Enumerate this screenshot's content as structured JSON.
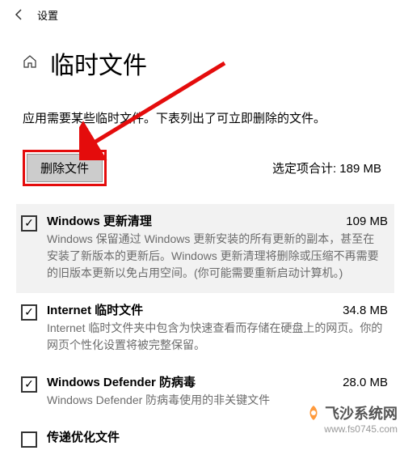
{
  "titlebar": {
    "settings_label": "设置"
  },
  "header": {
    "page_title": "临时文件"
  },
  "description": "应用需要某些临时文件。下表列出了可立即删除的文件。",
  "action": {
    "delete_label": "删除文件",
    "total_label": "选定项合计: 189 MB"
  },
  "items": [
    {
      "checked": true,
      "selected": true,
      "title": "Windows 更新清理",
      "size": "109 MB",
      "desc": "Windows 保留通过 Windows 更新安装的所有更新的副本，甚至在安装了新版本的更新后。Windows 更新清理将删除或压缩不再需要的旧版本更新以免占用空间。(你可能需要重新启动计算机。)"
    },
    {
      "checked": true,
      "selected": false,
      "title": "Internet 临时文件",
      "size": "34.8 MB",
      "desc": "Internet 临时文件夹中包含为快速查看而存储在硬盘上的网页。你的网页个性化设置将被完整保留。"
    },
    {
      "checked": true,
      "selected": false,
      "title": "Windows Defender 防病毒",
      "size": "28.0 MB",
      "desc": "Windows Defender 防病毒使用的非关键文件"
    },
    {
      "checked": false,
      "selected": false,
      "title": "传递优化文件",
      "size": "",
      "desc": ""
    }
  ],
  "watermark": {
    "title": "飞沙系统网",
    "url": "www.fs0745.com"
  }
}
